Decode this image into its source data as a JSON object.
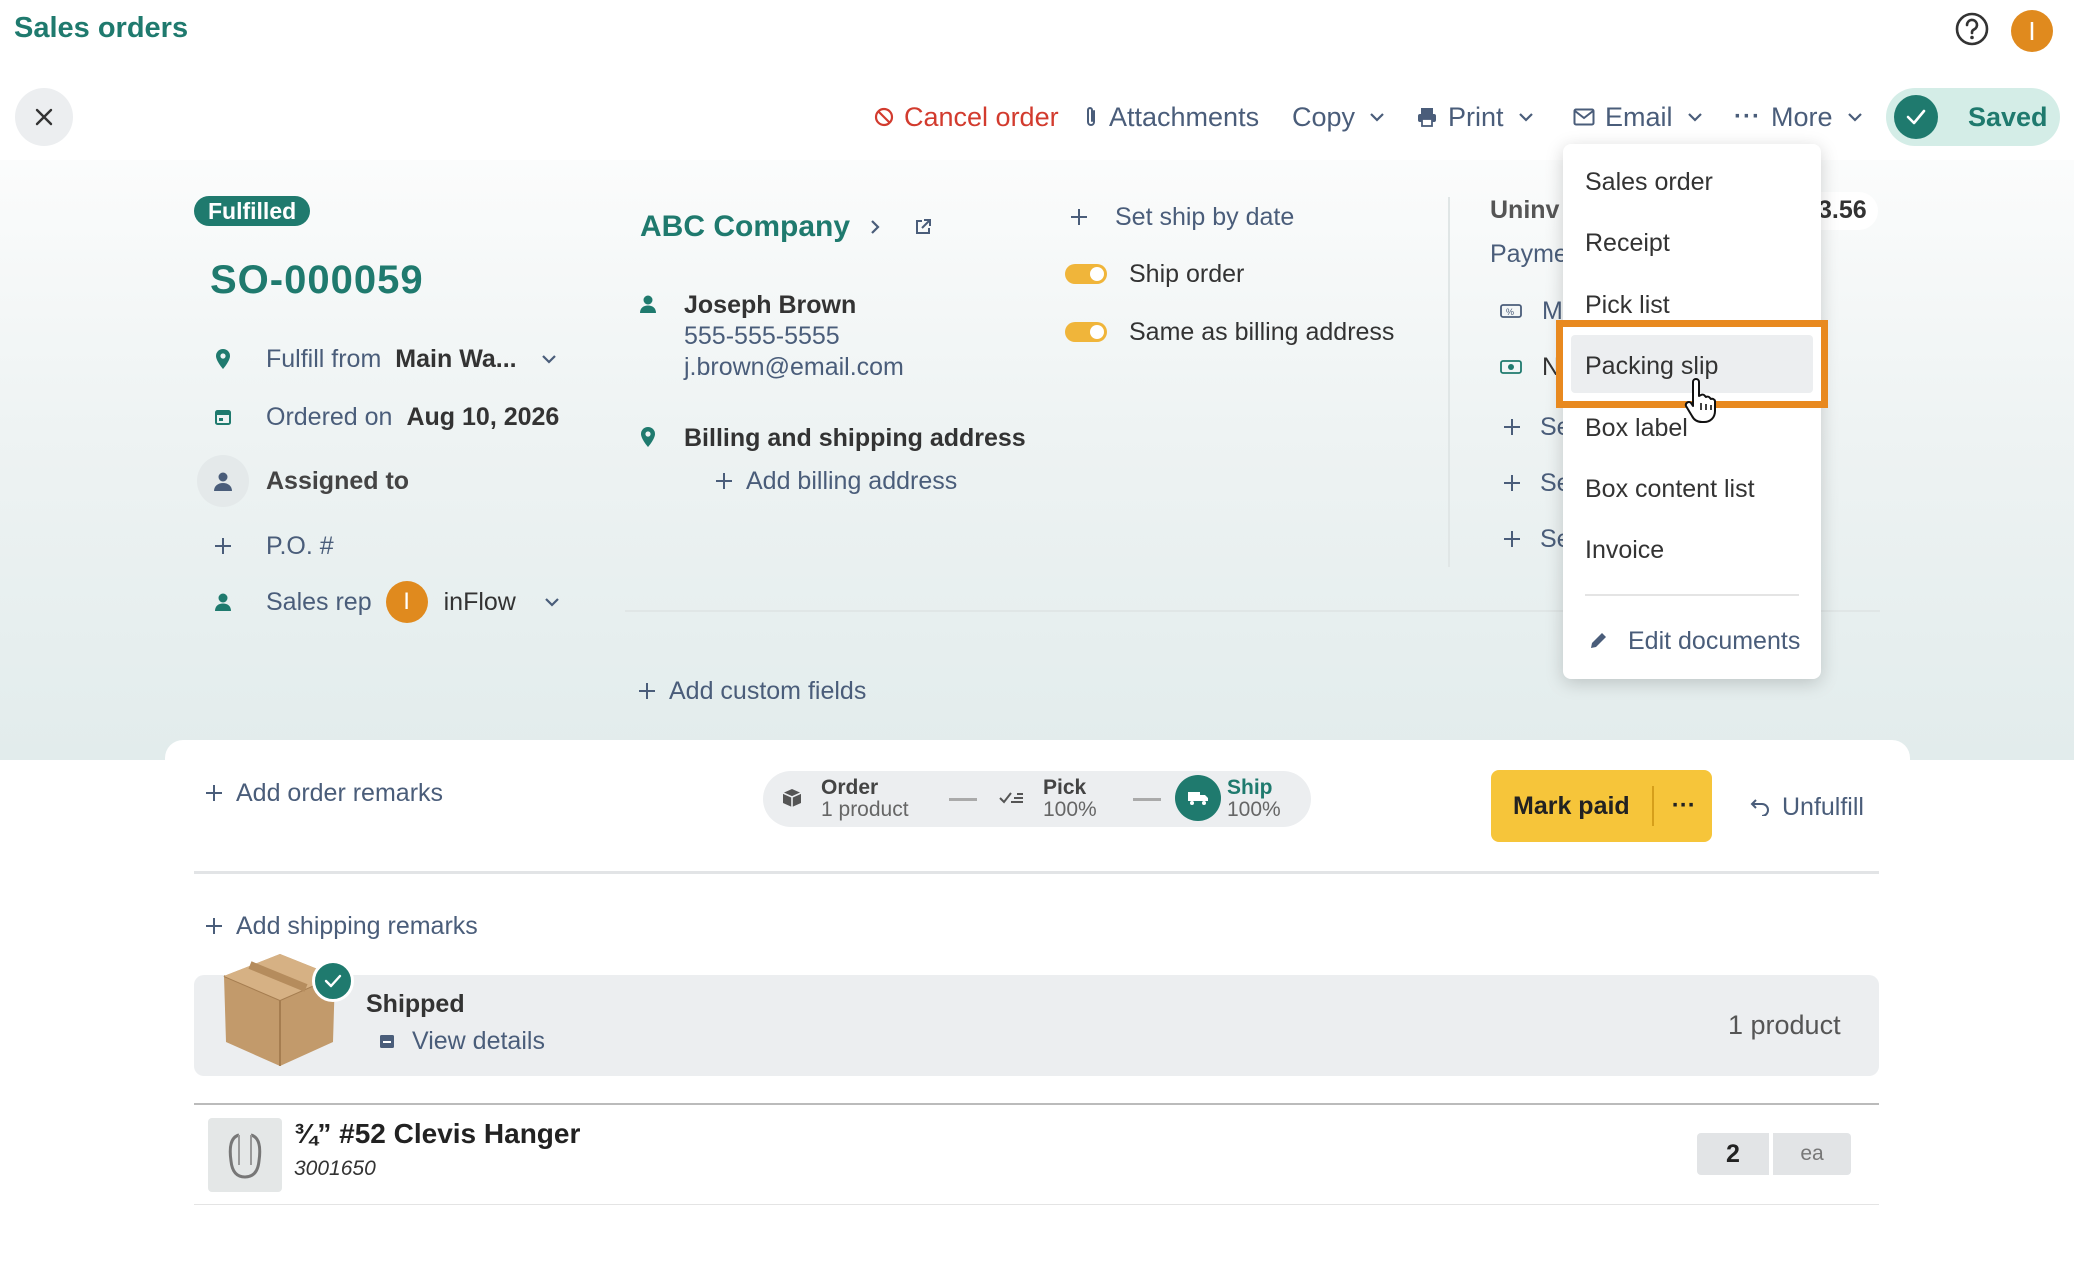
{
  "header": {
    "title": "Sales orders",
    "user_initial": "I"
  },
  "toolbar": {
    "cancel_label": "Cancel order",
    "attachments_label": "Attachments",
    "copy_label": "Copy",
    "print_label": "Print",
    "email_label": "Email",
    "more_label": "More",
    "saved_label": "Saved"
  },
  "order": {
    "status": "Fulfilled",
    "number": "SO-000059",
    "fulfill_from_label": "Fulfill from",
    "fulfill_from_value": "Main Wa...",
    "ordered_on_label": "Ordered on",
    "ordered_on_value": "Aug 10, 2026",
    "assigned_to_label": "Assigned to",
    "po_label": "P.O. #",
    "sales_rep_label": "Sales rep",
    "sales_rep_initial": "I",
    "sales_rep_value": "inFlow"
  },
  "customer": {
    "company": "ABC Company",
    "contact_name": "Joseph Brown",
    "phone": "555-555-5555",
    "email": "j.brown@email.com",
    "address_heading": "Billing and shipping address",
    "add_billing_label": "Add billing address",
    "add_custom_fields_label": "Add custom fields"
  },
  "shipping": {
    "set_ship_date_label": "Set ship by date",
    "ship_order_label": "Ship order",
    "same_as_billing_label": "Same as billing address",
    "ship_order_on": true,
    "same_as_billing_on": true
  },
  "payment_partial": {
    "title_fragment": "Uninv",
    "amount_fragment": "3.56",
    "payment_fragment": "Payme",
    "line1_fragment": "M",
    "line2_fragment": "N",
    "set1_fragment": "Se",
    "set2_fragment": "Se",
    "set3_fragment": "Se"
  },
  "print_menu": {
    "items": [
      "Sales order",
      "Receipt",
      "Pick list",
      "Packing slip",
      "Box label",
      "Box content list",
      "Invoice"
    ],
    "edit_label": "Edit documents",
    "highlighted_index": 3
  },
  "remarks": {
    "add_order_remarks": "Add order remarks",
    "add_shipping_remarks": "Add shipping remarks"
  },
  "progress": {
    "steps": [
      {
        "title": "Order",
        "sub": "1 product"
      },
      {
        "title": "Pick",
        "sub": "100%"
      },
      {
        "title": "Ship",
        "sub": "100%"
      }
    ]
  },
  "actions": {
    "mark_paid": "Mark paid",
    "more": "···",
    "unfulfill": "Unfulfill"
  },
  "shipment": {
    "status": "Shipped",
    "view_details": "View details",
    "count": "1 product"
  },
  "line_item": {
    "name": "¾” #52 Clevis Hanger",
    "sku": "3001650",
    "quantity": "2",
    "unit": "ea"
  },
  "colors": {
    "teal": "#1f7a6e",
    "orange": "#e08a1e",
    "yellow": "#f6c53a",
    "red": "#d23b2e",
    "slate": "#4a5d7a",
    "highlight": "#e8891f"
  }
}
